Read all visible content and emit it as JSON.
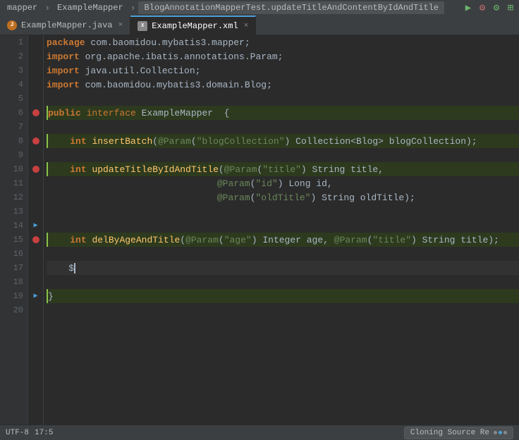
{
  "topbar": {
    "items": [
      "mapper",
      "ExampleMapper",
      "BlogAnnotationMapperTest.updateTitleAndContentByIdAndTitle"
    ],
    "run_icon": "▶",
    "debug_icon": "⚙"
  },
  "tabs": [
    {
      "id": "java",
      "label": "ExampleMapper.java",
      "type": "java",
      "active": false
    },
    {
      "id": "xml",
      "label": "ExampleMapper.xml",
      "type": "xml",
      "active": true
    }
  ],
  "code": {
    "lines": [
      {
        "num": 1,
        "content": "package com.baomidou.mybatis3.mapper;",
        "type": "package"
      },
      {
        "num": 2,
        "content": "import org.apache.ibatis.annotations.Param;",
        "type": "import"
      },
      {
        "num": 3,
        "content": "import java.util.Collection;",
        "type": "import"
      },
      {
        "num": 4,
        "content": "import com.baomidou.mybatis3.domain.Blog;",
        "type": "import"
      },
      {
        "num": 5,
        "content": "",
        "type": "empty"
      },
      {
        "num": 6,
        "content": "public interface ExampleMapper  {",
        "type": "interface-decl"
      },
      {
        "num": 7,
        "content": "",
        "type": "empty"
      },
      {
        "num": 8,
        "content": "    int insertBatch(@Param(\"blogCollection\") Collection<Blog> blogCollection);",
        "type": "method"
      },
      {
        "num": 9,
        "content": "",
        "type": "empty"
      },
      {
        "num": 10,
        "content": "    int updateTitleByIdAndTitle(@Param(\"title\") String title,",
        "type": "method"
      },
      {
        "num": 11,
        "content": "                               @Param(\"id\") Long id,",
        "type": "continuation"
      },
      {
        "num": 12,
        "content": "                               @Param(\"oldTitle\") String oldTitle);",
        "type": "continuation"
      },
      {
        "num": 13,
        "content": "",
        "type": "empty"
      },
      {
        "num": 14,
        "content": "",
        "type": "empty-arrow"
      },
      {
        "num": 15,
        "content": "    int delByAgeAndTitle(@Param(\"age\") Integer age, @Param(\"title\") String title);",
        "type": "method"
      },
      {
        "num": 16,
        "content": "",
        "type": "empty"
      },
      {
        "num": 17,
        "content": "    $",
        "type": "cursor"
      },
      {
        "num": 18,
        "content": "",
        "type": "empty"
      },
      {
        "num": 19,
        "content": "}",
        "type": "brace"
      },
      {
        "num": 20,
        "content": "",
        "type": "empty"
      }
    ]
  },
  "status": {
    "cloning_label": "Cloning Source Re",
    "progress_dots": [
      0,
      1,
      2
    ]
  }
}
